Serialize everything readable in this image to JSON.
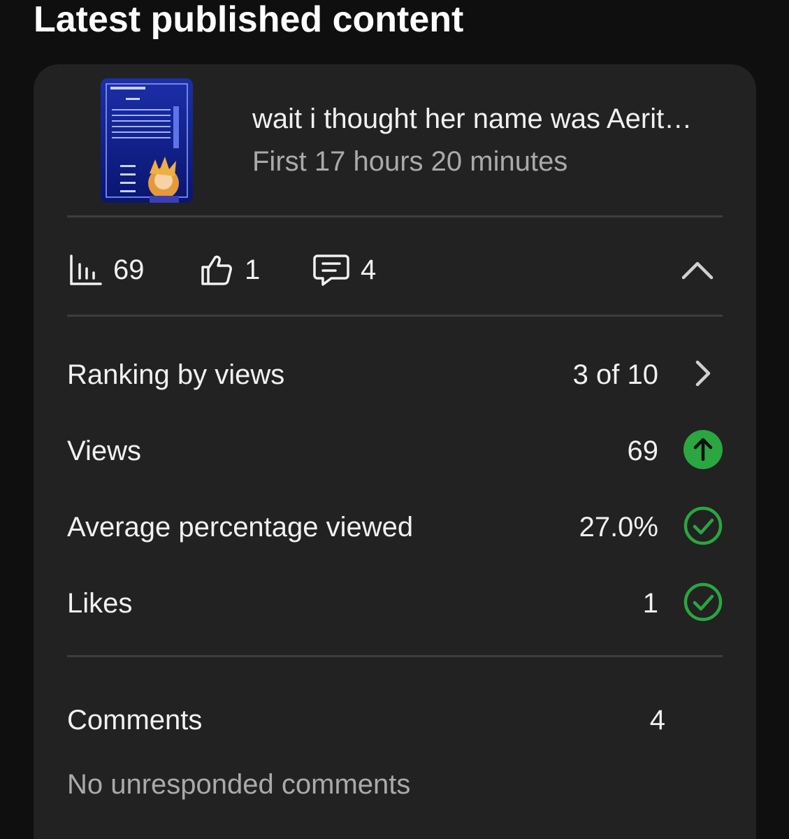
{
  "section": {
    "title": "Latest published content"
  },
  "video": {
    "title": "wait i thought her name was Aerit…",
    "subtitle": "First 17 hours 20 minutes",
    "thumbnail_icon": "video-thumbnail"
  },
  "stats": {
    "views": "69",
    "likes": "1",
    "comments": "4"
  },
  "metrics": [
    {
      "label": "Ranking by views",
      "value": "3 of 10",
      "indicator": "chevron-right-icon"
    },
    {
      "label": "Views",
      "value": "69",
      "indicator": "arrow-up-circle-icon"
    },
    {
      "label": "Average percentage viewed",
      "value": "27.0%",
      "indicator": "check-circle-icon"
    },
    {
      "label": "Likes",
      "value": "1",
      "indicator": "check-circle-icon"
    }
  ],
  "comments_section": {
    "label": "Comments",
    "value": "4",
    "status": "No unresponded comments"
  },
  "colors": {
    "background": "#0f0f0f",
    "card": "#222222",
    "divider": "#3d3d3d",
    "text_primary": "#f1f1f1",
    "text_secondary": "#aaaaaa",
    "success_green": "#2ba640"
  }
}
